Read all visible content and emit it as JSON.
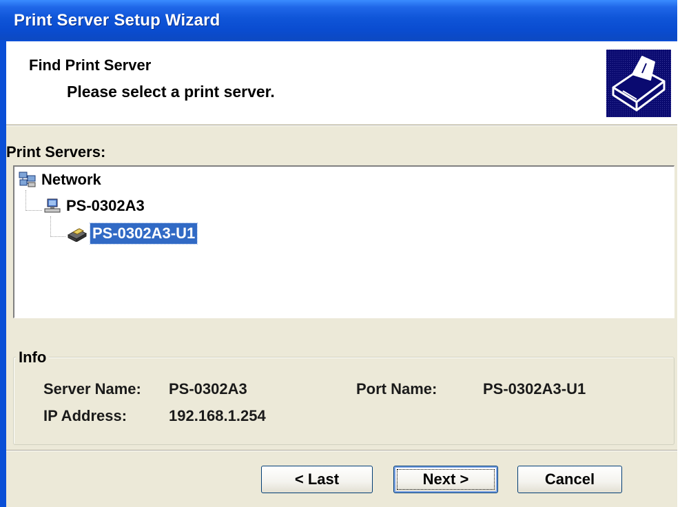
{
  "window": {
    "title": "Print Server Setup Wizard"
  },
  "header": {
    "title": "Find Print Server",
    "subtitle": "Please select a print server.",
    "icon": "printer-icon"
  },
  "servers": {
    "label": "Print Servers:",
    "tree": [
      {
        "label": "Network",
        "icon": "network-icon",
        "level": 0,
        "selected": false
      },
      {
        "label": "PS-0302A3",
        "icon": "computer-icon",
        "level": 1,
        "selected": false
      },
      {
        "label": "PS-0302A3-U1",
        "icon": "printer-port-icon",
        "level": 2,
        "selected": true
      }
    ]
  },
  "info": {
    "legend": "Info",
    "server_name_label": "Server Name:",
    "server_name_value": "PS-0302A3",
    "port_name_label": "Port Name:",
    "port_name_value": "PS-0302A3-U1",
    "ip_label": "IP Address:",
    "ip_value": "192.168.1.254"
  },
  "buttons": {
    "last": "< Last",
    "next": "Next >",
    "cancel": "Cancel"
  },
  "colors": {
    "title_bar": "#0a4cd0",
    "dialog_bg": "#ece9d8",
    "selection": "#316ac5",
    "header_icon_bg": "#0a0a70"
  }
}
